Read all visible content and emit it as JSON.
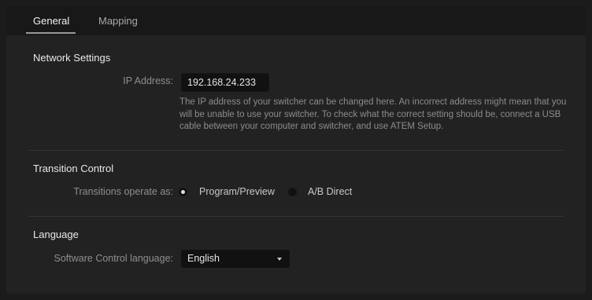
{
  "tabs": [
    {
      "label": "General",
      "active": true
    },
    {
      "label": "Mapping",
      "active": false
    }
  ],
  "network": {
    "title": "Network Settings",
    "ip_label": "IP Address:",
    "ip_value": "192.168.24.233",
    "help": "The IP address of your switcher can be changed here. An incorrect address might mean that you will be unable to use your switcher. To check what the correct setting should be, connect a USB cable between your computer and switcher, and use ATEM Setup."
  },
  "transition": {
    "title": "Transition Control",
    "label": "Transitions operate as:",
    "options": [
      {
        "label": "Program/Preview",
        "selected": true
      },
      {
        "label": "A/B Direct",
        "selected": false
      }
    ]
  },
  "language": {
    "title": "Language",
    "label": "Software Control language:",
    "selected": "English"
  },
  "icons": {
    "dropdown": "chevron-down-icon"
  }
}
